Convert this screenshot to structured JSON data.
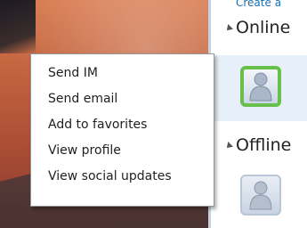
{
  "contact_panel": {
    "create_link": "Create a",
    "groups": [
      {
        "label": "Online"
      },
      {
        "label": "Offline"
      }
    ]
  },
  "context_menu": {
    "items": [
      {
        "label": "Send IM"
      },
      {
        "label": "Send email"
      },
      {
        "label": "Add to favorites"
      },
      {
        "label": "View profile"
      },
      {
        "label": "View social updates"
      }
    ]
  },
  "icons": {
    "contact_avatar_online": "person-icon",
    "contact_avatar_offline": "person-icon"
  },
  "colors": {
    "online_status": "#66c04b",
    "link": "#1a6fb0"
  }
}
